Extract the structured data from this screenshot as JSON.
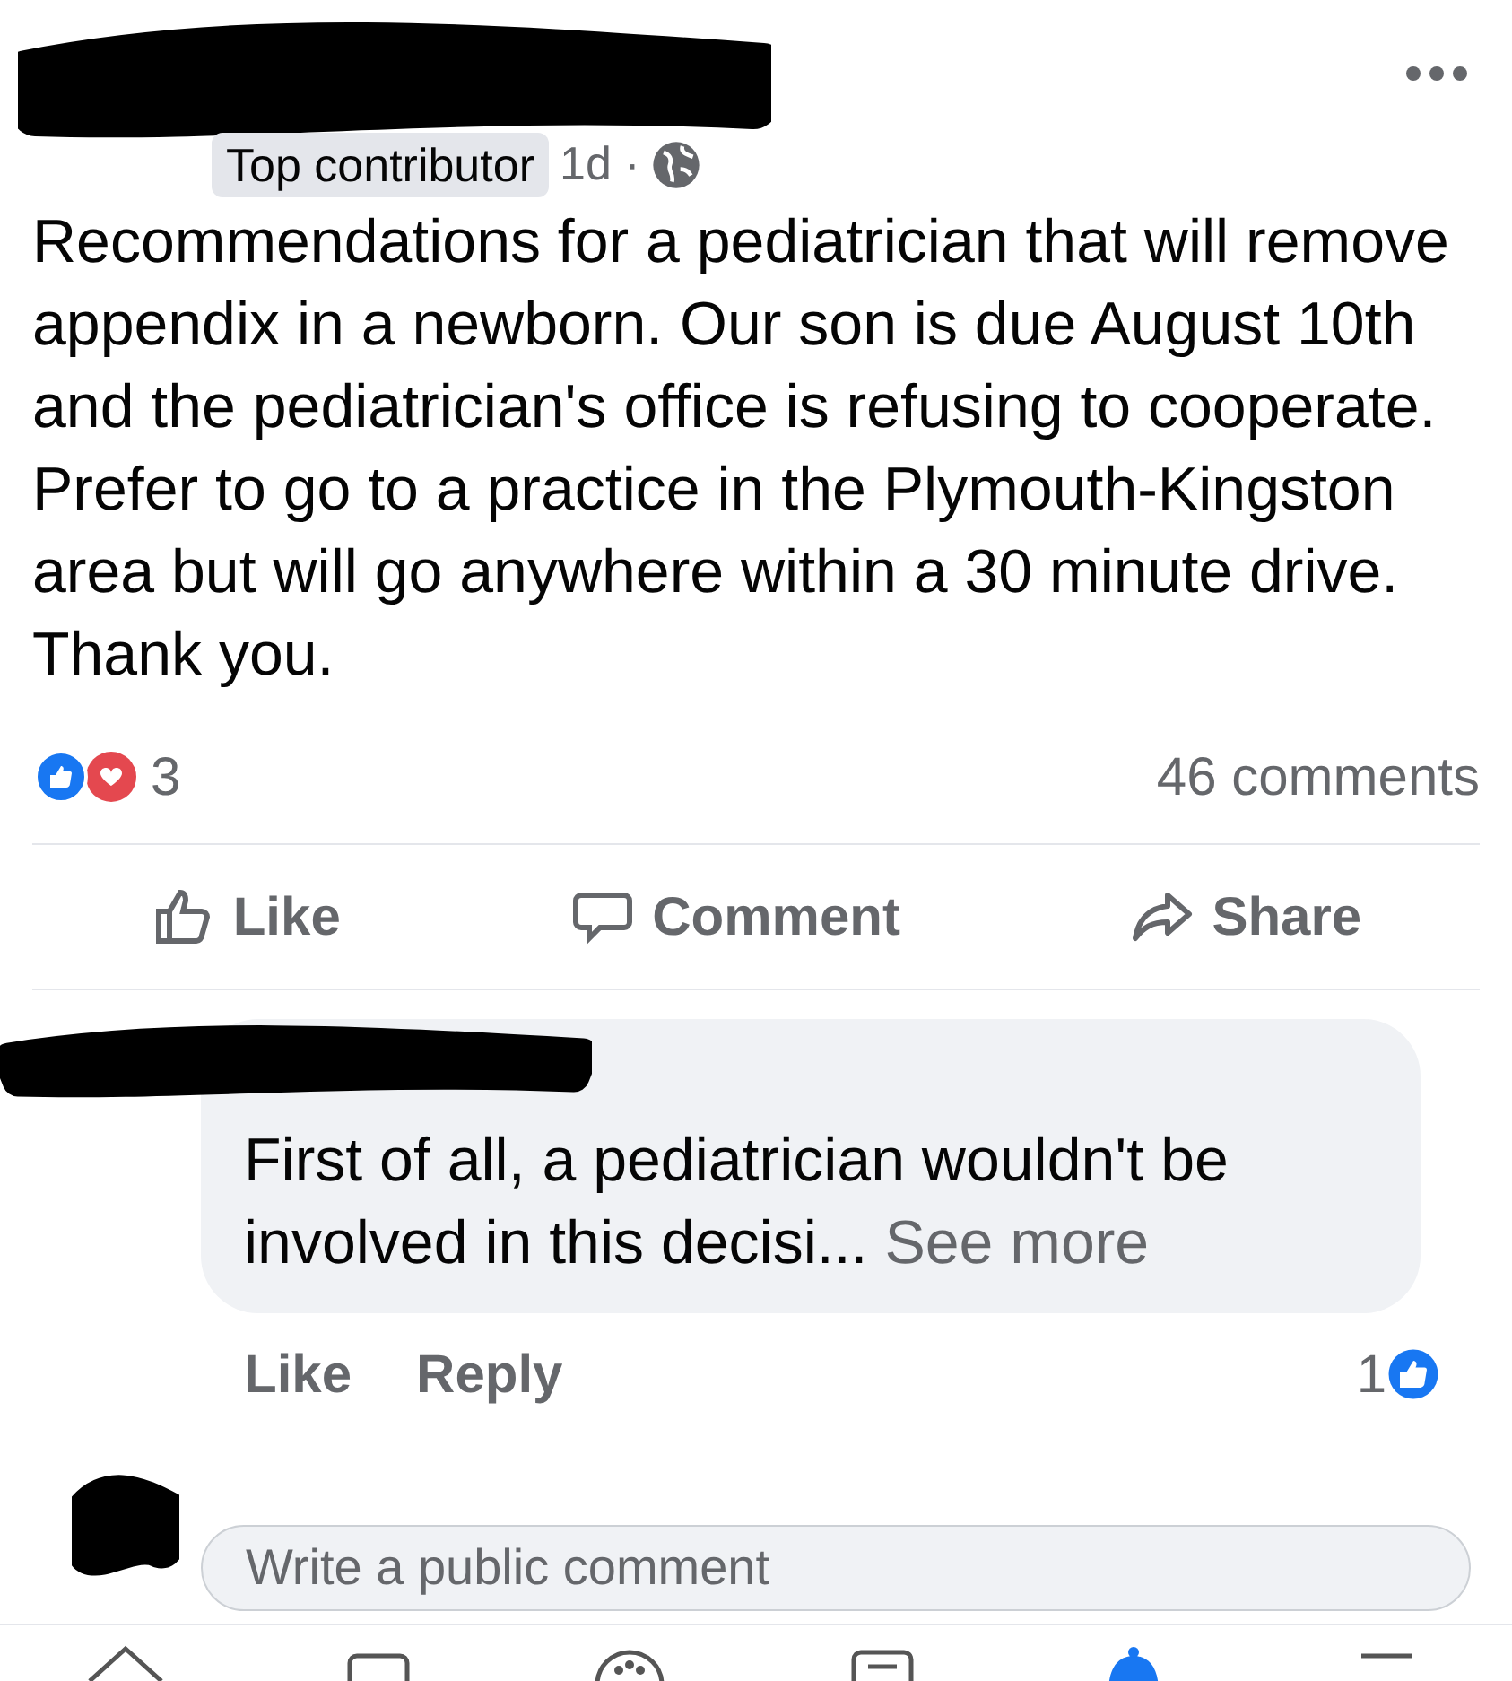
{
  "post": {
    "badge": "Top contributor",
    "time": "1d ·",
    "text": "Recommendations for a pediatrician that will remove appendix in a newborn. Our son is due August 10th and the pediatrician's office is refusing to cooperate.  Prefer to go to a practice in the Plymouth-Kingston area but will go anywhere within a 30 minute drive. Thank you.",
    "reaction_count": "3",
    "comment_count": "46 comments"
  },
  "actions": [
    {
      "kind": "like",
      "label": "Like"
    },
    {
      "kind": "comment",
      "label": "Comment"
    },
    {
      "kind": "share",
      "label": "Share"
    }
  ],
  "comment": {
    "text": "First of all, a pediatrician wouldn't be involved in this decisi...",
    "see_more": "See more",
    "actions": [
      "Like",
      "Reply"
    ],
    "like_count": "1"
  },
  "reply_field": {
    "placeholder": "Write a public comment"
  },
  "nav_tabs": [
    {
      "kind": "home",
      "selected": false
    },
    {
      "kind": "video",
      "selected": false
    },
    {
      "kind": "groups",
      "selected": false
    },
    {
      "kind": "news",
      "selected": false
    },
    {
      "kind": "bell",
      "selected": true
    },
    {
      "kind": "menu",
      "selected": false
    }
  ]
}
